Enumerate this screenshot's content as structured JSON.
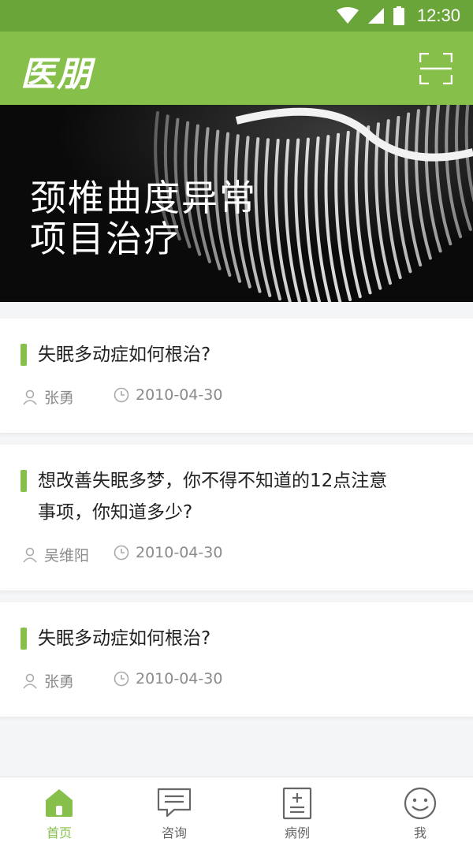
{
  "status_bar": {
    "time": "12:30"
  },
  "app_bar": {
    "logo": "医朋",
    "scan_icon": "scan-frame-icon"
  },
  "banner": {
    "title_line1": "颈椎曲度异常",
    "title_line2": "项目治疗"
  },
  "articles": [
    {
      "title": "失眠多动症如何根治?",
      "author": "张勇",
      "date": "2010-04-30"
    },
    {
      "title_line1": "想改善失眠多梦，你不得不知道的12点注意",
      "title_line2": "事项，你知道多少?",
      "author": "吴维阳",
      "date": "2010-04-30"
    },
    {
      "title": "失眠多动症如何根治?",
      "author": "张勇",
      "date": "2010-04-30"
    }
  ],
  "tabs": [
    {
      "label": "首页",
      "icon": "home-icon",
      "active": true
    },
    {
      "label": "咨询",
      "icon": "chat-icon"
    },
    {
      "label": "病例",
      "icon": "record-icon"
    },
    {
      "label": "我",
      "icon": "smile-icon"
    }
  ],
  "colors": {
    "accent": "#86c04b",
    "status_bar": "#6aa53a",
    "banner_bg": "#0a0a0a"
  }
}
